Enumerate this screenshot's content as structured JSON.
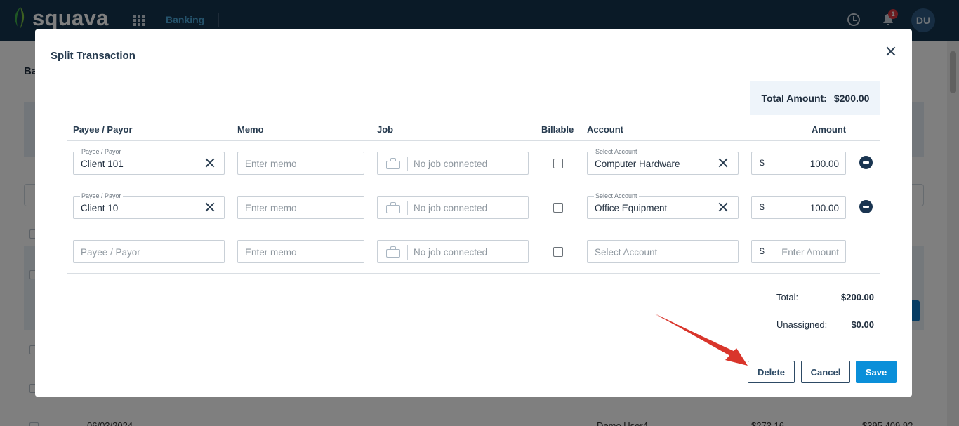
{
  "app": {
    "logo_text": "squava",
    "nav_active": "Banking",
    "notification_count": "1",
    "user_initials": "DU"
  },
  "background": {
    "page_title_fragment": "Ba",
    "row_date": "06/03/2024",
    "row_user": "Demo User4",
    "row_amount": "$273.16",
    "row_balance": "$395,409.92"
  },
  "modal": {
    "title": "Split Transaction",
    "total_amount_label": "Total Amount:",
    "total_amount_value": "$200.00",
    "columns": {
      "payee": "Payee / Payor",
      "memo": "Memo",
      "job": "Job",
      "billable": "Billable",
      "account": "Account",
      "amount": "Amount"
    },
    "rows": [
      {
        "payee_label": "Payee / Payor",
        "payee": "Client 101",
        "memo_placeholder": "Enter memo",
        "job_placeholder": "No job connected",
        "billable": false,
        "account_label": "Select Account",
        "account": "Computer Hardware",
        "currency": "$",
        "amount": "100.00"
      },
      {
        "payee_label": "Payee / Payor",
        "payee": "Client 10",
        "memo_placeholder": "Enter memo",
        "job_placeholder": "No job connected",
        "billable": false,
        "account_label": "Select Account",
        "account": "Office Equipment",
        "currency": "$",
        "amount": "100.00"
      }
    ],
    "new_row": {
      "payee_placeholder": "Payee / Payor",
      "memo_placeholder": "Enter memo",
      "job_placeholder": "No job connected",
      "account_placeholder": "Select Account",
      "currency": "$",
      "amount_placeholder": "Enter Amount"
    },
    "summary": {
      "total_label": "Total:",
      "total_value": "$200.00",
      "unassigned_label": "Unassigned:",
      "unassigned_value": "$0.00"
    },
    "buttons": {
      "delete": "Delete",
      "cancel": "Cancel",
      "save": "Save"
    }
  },
  "colors": {
    "topbar": "#15354f",
    "accent": "#0a8fd9",
    "annotation_arrow": "#d9352b"
  },
  "icons": [
    "apps-grid-icon",
    "clock-icon",
    "bell-icon",
    "close-icon",
    "clear-icon",
    "briefcase-icon",
    "remove-row-icon",
    "arrow-annotation"
  ]
}
